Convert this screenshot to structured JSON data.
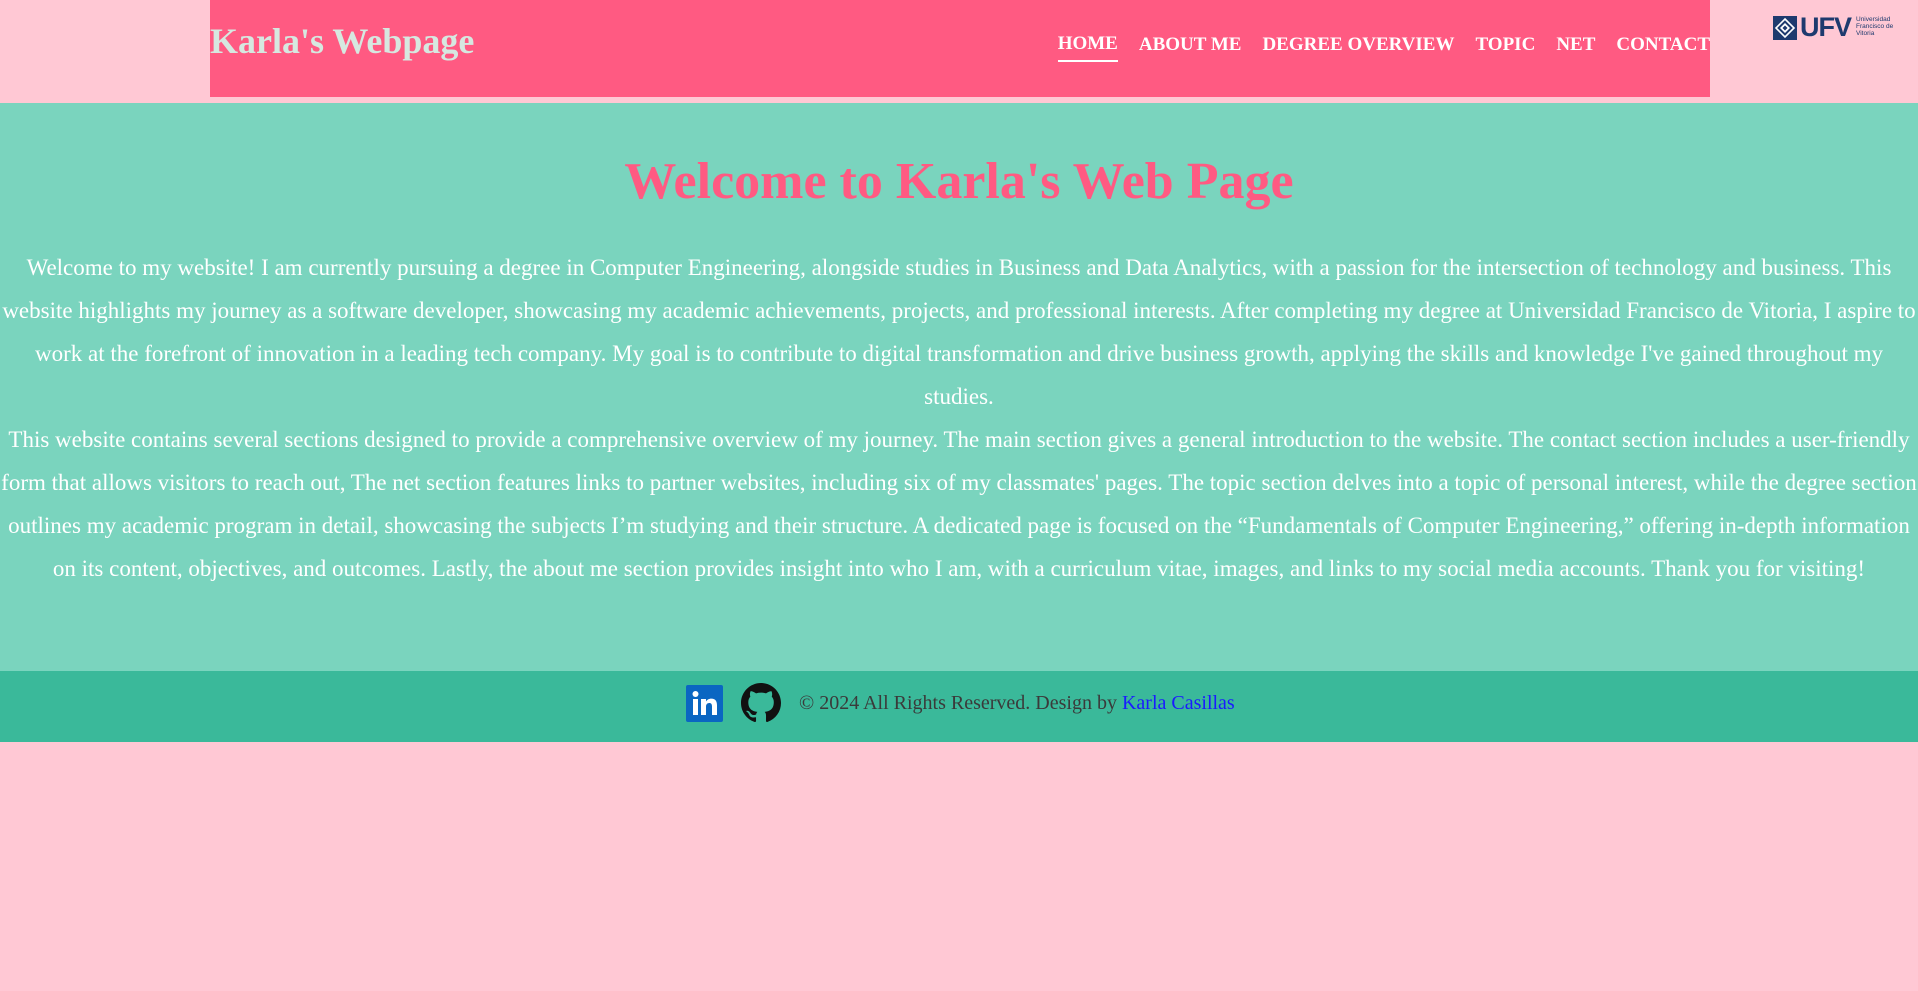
{
  "header": {
    "site_title": "Karla's Webpage",
    "nav": [
      {
        "label": "HOME",
        "active": true
      },
      {
        "label": "ABOUT ME",
        "active": false
      },
      {
        "label": "DEGREE OVERVIEW",
        "active": false
      },
      {
        "label": "TOPIC",
        "active": false
      },
      {
        "label": "NET",
        "active": false
      },
      {
        "label": "CONTACT",
        "active": false
      }
    ],
    "logo": {
      "text": "UFV",
      "sub": "Universidad Francisco de Vitoria",
      "icon": "ufv-logo-icon"
    }
  },
  "main": {
    "title": "Welcome to Karla's Web Page",
    "paragraph1": "Welcome to my website! I am currently pursuing a degree in Computer Engineering, alongside studies in Business and Data Analytics, with a passion for the intersection of technology and business. This website highlights my journey as a software developer, showcasing my academic achievements, projects, and professional interests. After completing my degree at Universidad Francisco de Vitoria, I aspire to work at the forefront of innovation in a leading tech company. My goal is to contribute to digital transformation and drive business growth, applying the skills and knowledge I've gained throughout my studies.",
    "paragraph2": "This website contains several sections designed to provide a comprehensive overview of my journey. The main section gives a general introduction to the website. The contact section includes a user-friendly form that allows visitors to reach out, The net section features links to partner websites, including six of my classmates' pages. The topic section delves into a topic of personal interest, while the degree section outlines my academic program in detail, showcasing the subjects I’m studying and their structure. A dedicated page is focused on the “Fundamentals of Computer Engineering,” offering in-depth information on its content, objectives, and outcomes. Lastly, the about me section provides insight into who I am, with a curriculum vitae, images, and links to my social media accounts. Thank you for visiting!"
  },
  "footer": {
    "copyright": "© 2024 All Rights Reserved. Design by ",
    "author": "Karla Casillas",
    "icons": [
      "linkedin-icon",
      "github-icon"
    ]
  },
  "colors": {
    "page_bg": "#ffc8d4",
    "header_bg": "#ff5a82",
    "main_bg": "#7ad4be",
    "footer_bg": "#3ab99a",
    "accent": "#ff5a82",
    "link": "#1a1aff"
  }
}
